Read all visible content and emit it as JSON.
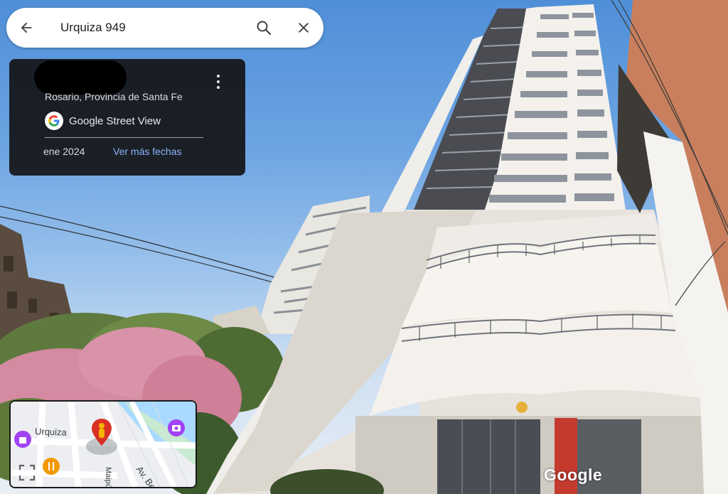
{
  "search": {
    "query": "Urquiza 949",
    "back_icon": "arrow-left-icon",
    "search_icon": "search-icon",
    "close_icon": "close-icon"
  },
  "info_card": {
    "location": "Rosario, Provincia de Santa Fe",
    "provider": "Google Street View",
    "date": "ene 2024",
    "more_dates_link": "Ver más fechas",
    "menu_icon": "more-vert-icon",
    "link_color": "#8ab4f8"
  },
  "minimap": {
    "street_primary": "Urquiza",
    "street_secondary": "Av. Be",
    "street_tertiary": "Maipú",
    "pegman_icon": "pegman-icon",
    "expand_icon": "fullscreen-icon",
    "poi_icons": [
      "camera-poi-icon",
      "restaurant-poi-icon",
      "shopping-poi-icon"
    ]
  },
  "watermark": {
    "label": "Google"
  }
}
